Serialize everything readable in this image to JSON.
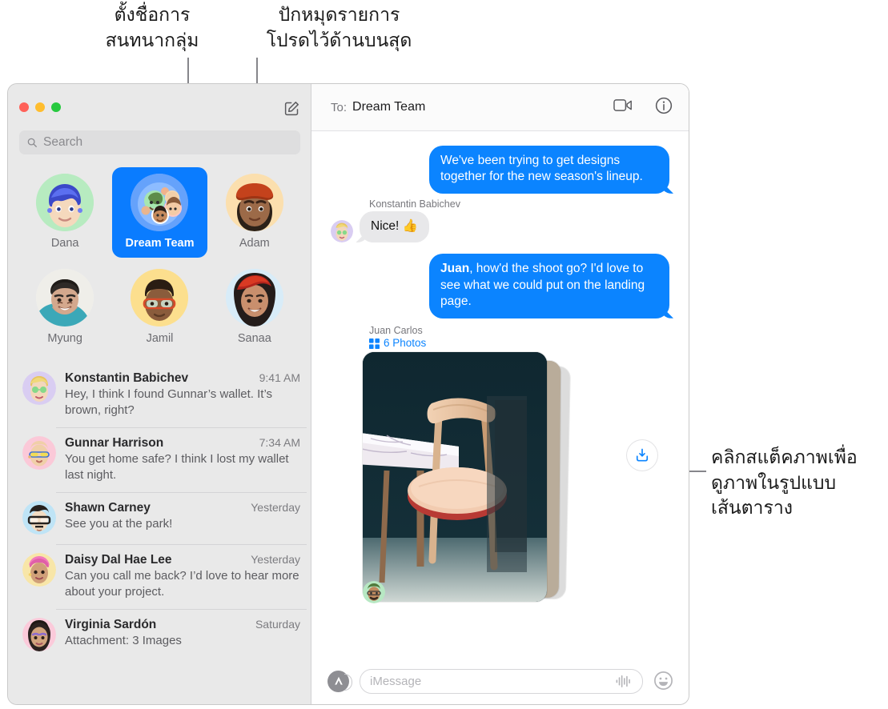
{
  "callouts": {
    "group_name": "ตั้งชื่อการ\nสนทนากลุ่ม",
    "group_name_line1": "ตั้งชื่อการ",
    "group_name_line2": "สนทนากลุ่ม",
    "pin_top_line1": "ปักหมุดรายการ",
    "pin_top_line2": "โปรดไว้ด้านบนสุด",
    "stack_line1": "คลิกสแต็คภาพเพื่อ",
    "stack_line2": "ดูภาพในรูปแบบ",
    "stack_line3": "เส้นตาราง"
  },
  "colors": {
    "accent_blue": "#0b84ff",
    "selected_pin": "#0a7cff",
    "bubble_gray": "#e8e8ea",
    "sidebar_bg": "#e9e9e9",
    "traffic_red": "#ff6159",
    "traffic_yellow": "#ffbd2e",
    "traffic_green": "#27c93f"
  },
  "sidebar": {
    "window_controls": [
      "close",
      "minimize",
      "zoom"
    ],
    "compose_icon": "compose-icon",
    "search": {
      "placeholder": "Search",
      "value": "",
      "icon": "search-icon"
    },
    "pinned": [
      {
        "name": "Dana",
        "selected": false,
        "avatar": "memoji-blue-hair"
      },
      {
        "name": "Dream Team",
        "selected": true,
        "avatar": "group-memoji"
      },
      {
        "name": "Adam",
        "selected": false,
        "avatar": "memoji-red-cap"
      },
      {
        "name": "Myung",
        "selected": false,
        "avatar": "photo-myung"
      },
      {
        "name": "Jamil",
        "selected": false,
        "avatar": "memoji-glasses"
      },
      {
        "name": "Sanaa",
        "selected": false,
        "avatar": "photo-sanaa"
      }
    ],
    "conversations": [
      {
        "name": "Konstantin Babichev",
        "time": "9:41 AM",
        "preview": "Hey, I think I found Gunnar’s wallet. It’s brown, right?",
        "avatar": "memoji-green-glasses"
      },
      {
        "name": "Gunnar Harrison",
        "time": "7:34 AM",
        "preview": "You get home safe? I think I lost my wallet last night.",
        "avatar": "memoji-yellow-glasses"
      },
      {
        "name": "Shawn Carney",
        "time": "Yesterday",
        "preview": "See you at the park!",
        "avatar": "memoji-black-glasses"
      },
      {
        "name": "Daisy Dal Hae Lee",
        "time": "Yesterday",
        "preview": "Can you call me back? I’d love to hear more about your project.",
        "avatar": "memoji-pink-cap"
      },
      {
        "name": "Virginia Sardón",
        "time": "Saturday",
        "preview": "Attachment: 3 Images",
        "avatar": "memoji-purple-eyeshadow"
      }
    ]
  },
  "pane": {
    "header": {
      "to_label": "To:",
      "recipient": "Dream Team",
      "facetime_icon": "facetime-video-icon",
      "info_icon": "info-icon"
    },
    "messages": [
      {
        "direction": "outgoing",
        "text": "We've been trying to get designs together for the new season's lineup."
      },
      {
        "direction": "incoming",
        "sender": "Konstantin Babichev",
        "text": "Nice!  👍",
        "avatar": "memoji-green-glasses"
      },
      {
        "direction": "outgoing",
        "mention": "Juan",
        "text": ", how'd the shoot go? I'd love to see what we could put on the landing page."
      }
    ],
    "attachment": {
      "sender": "Juan Carlos",
      "count_label": "6 Photos",
      "grid_icon": "photo-grid-icon",
      "download_icon": "download-icon",
      "avatar": "memoji-green-beard"
    },
    "compose": {
      "apps_icon": "app-store-icon",
      "placeholder": "iMessage",
      "value": "",
      "audio_icon": "audio-waveform-icon",
      "emoji_icon": "emoji-smiley-icon"
    }
  }
}
